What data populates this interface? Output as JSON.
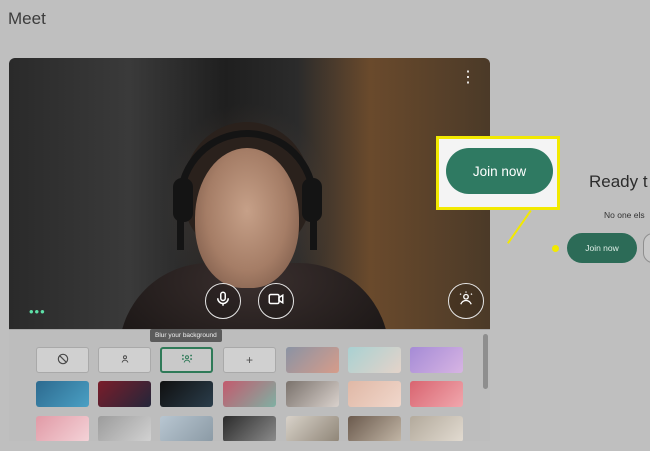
{
  "app": {
    "title": "Meet"
  },
  "preview": {
    "more_options_icon": "more-vert-icon",
    "visual_effects_icon": "three-dots-icon",
    "controls": [
      {
        "name": "microphone",
        "icon": "mic-icon"
      },
      {
        "name": "camera",
        "icon": "video-camera-icon"
      },
      {
        "name": "background",
        "icon": "background-effects-icon"
      }
    ]
  },
  "effects": {
    "tooltip": "Blur your background",
    "options": [
      {
        "name": "no-effect",
        "icon": "block-icon",
        "selected": false
      },
      {
        "name": "slight-blur",
        "icon": "person-blur-icon",
        "selected": false
      },
      {
        "name": "blur-background",
        "icon": "person-blur-strong-icon",
        "selected": true
      },
      {
        "name": "upload-background",
        "icon": "plus-icon",
        "glyph": "+",
        "selected": false
      }
    ],
    "backgrounds": [
      {
        "colors": [
          "#8a93a4",
          "#d69c8a"
        ]
      },
      {
        "colors": [
          "#a9d1d2",
          "#e4d3c9"
        ]
      },
      {
        "colors": [
          "#a58bd6",
          "#d7b4e3"
        ]
      },
      {
        "colors": [
          "#2d6a8f",
          "#4aa0c4"
        ]
      },
      {
        "colors": [
          "#7a1d2a",
          "#23263a"
        ]
      },
      {
        "colors": [
          "#101010",
          "#2a3d4b"
        ]
      },
      {
        "colors": [
          "#c35a6d",
          "#7fb0a3"
        ]
      },
      {
        "colors": [
          "#7a726c",
          "#d9d1cc"
        ]
      },
      {
        "colors": [
          "#e0b8a6",
          "#f0d7cb"
        ]
      },
      {
        "colors": [
          "#d96470",
          "#f0a7ad"
        ]
      },
      {
        "colors": [
          "#e19aa6",
          "#f4d3d8"
        ]
      },
      {
        "colors": [
          "#9c9c9c",
          "#d2d2d2"
        ]
      },
      {
        "colors": [
          "#b8c6d1",
          "#8b9aa5"
        ]
      },
      {
        "colors": [
          "#2b2b2b",
          "#8c8c8c"
        ]
      },
      {
        "colors": [
          "#d8d2c9",
          "#8f8577"
        ]
      },
      {
        "colors": [
          "#6b5a4d",
          "#c2b6a6"
        ]
      },
      {
        "colors": [
          "#b3aa9c",
          "#e2dbd1"
        ]
      },
      {
        "colors": [
          "#1b3c5a",
          "#b8752f"
        ]
      }
    ]
  },
  "join": {
    "highlight_label": "Join now",
    "ready_text": "Ready t",
    "no_one_text": "No one els",
    "join_label": "Join now",
    "accent": "#2f7a62",
    "highlight_color": "#f2e900"
  }
}
